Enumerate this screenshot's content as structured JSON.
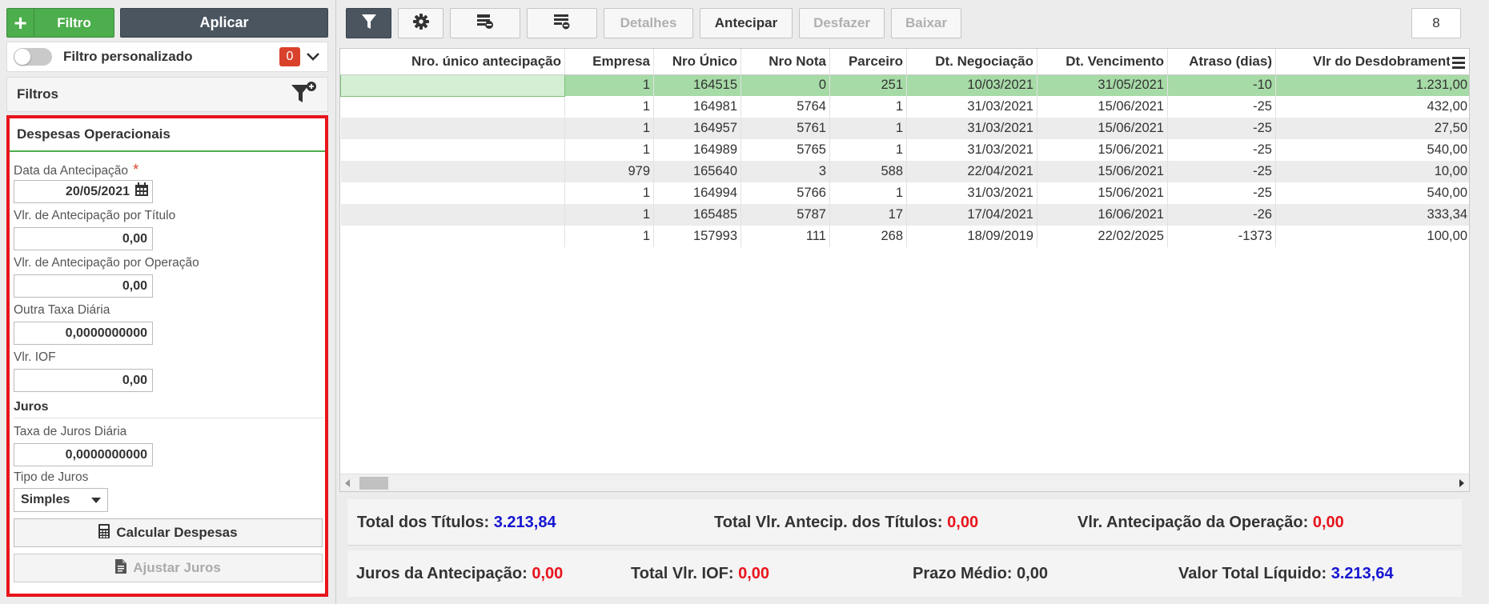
{
  "left": {
    "filtro_button": "Filtro",
    "aplicar_button": "Aplicar",
    "custom_filter": {
      "label": "Filtro personalizado",
      "count": "0"
    },
    "filtros_label": "Filtros",
    "ops": {
      "title": "Despesas Operacionais",
      "data_antecipacao_label": "Data da Antecipação",
      "required_mark": "*",
      "data_antecipacao_value": "20/05/2021",
      "vlr_titulo_label": "Vlr. de Antecipação por Título",
      "vlr_titulo_value": "0,00",
      "vlr_operacao_label": "Vlr. de Antecipação por Operação",
      "vlr_operacao_value": "0,00",
      "outra_taxa_label": "Outra Taxa Diária",
      "outra_taxa_value": "0,0000000000",
      "vlr_iof_label": "Vlr. IOF",
      "vlr_iof_value": "0,00",
      "juros_section": "Juros",
      "taxa_juros_label": "Taxa de Juros Diária",
      "taxa_juros_value": "0,0000000000",
      "tipo_juros_label": "Tipo de Juros",
      "tipo_juros_value": "Simples",
      "calcular_button": "Calcular Despesas",
      "ajustar_button": "Ajustar Juros"
    }
  },
  "toolbar": {
    "detalhes": "Detalhes",
    "antecipar": "Antecipar",
    "desfazer": "Desfazer",
    "baixar": "Baixar",
    "page_count": "8"
  },
  "grid": {
    "columns": [
      "Nro. único antecipação",
      "Empresa",
      "Nro Único",
      "Nro Nota",
      "Parceiro",
      "Dt. Negociação",
      "Dt. Vencimento",
      "Atraso (dias)",
      "Vlr do Desdobramento"
    ],
    "rows": [
      [
        "",
        "1",
        "164515",
        "0",
        "251",
        "10/03/2021",
        "31/05/2021",
        "-10",
        "1.231,00"
      ],
      [
        "",
        "1",
        "164981",
        "5764",
        "1",
        "31/03/2021",
        "15/06/2021",
        "-25",
        "432,00"
      ],
      [
        "",
        "1",
        "164957",
        "5761",
        "1",
        "31/03/2021",
        "15/06/2021",
        "-25",
        "27,50"
      ],
      [
        "",
        "1",
        "164989",
        "5765",
        "1",
        "31/03/2021",
        "15/06/2021",
        "-25",
        "540,00"
      ],
      [
        "",
        "979",
        "165640",
        "3",
        "588",
        "22/04/2021",
        "15/06/2021",
        "-25",
        "10,00"
      ],
      [
        "",
        "1",
        "164994",
        "5766",
        "1",
        "31/03/2021",
        "15/06/2021",
        "-25",
        "540,00"
      ],
      [
        "",
        "1",
        "165485",
        "5787",
        "17",
        "17/04/2021",
        "16/06/2021",
        "-26",
        "333,34"
      ],
      [
        "",
        "1",
        "157993",
        "111",
        "268",
        "18/09/2019",
        "22/02/2025",
        "-1373",
        "100,00"
      ]
    ]
  },
  "totals": {
    "total_titulos_label": "Total dos Títulos:",
    "total_titulos_value": "3.213,84",
    "total_antecip_label": "Total Vlr. Antecip. dos Títulos:",
    "total_antecip_value": "0,00",
    "vlr_antecip_op_label": "Vlr. Antecipação da Operação:",
    "vlr_antecip_op_value": "0,00",
    "juros_antecip_label": "Juros da Antecipação:",
    "juros_antecip_value": "0,00",
    "total_iof_label": "Total Vlr. IOF:",
    "total_iof_value": "0,00",
    "prazo_medio_label": "Prazo Médio:",
    "prazo_medio_value": "0,00",
    "valor_liquido_label": "Valor Total Líquido:",
    "valor_liquido_value": "3.213,64"
  },
  "colors": {
    "green": "#4cae4c",
    "dark": "#4a5560",
    "red": "#e8141c",
    "blue": "#1515d0",
    "selected_row": "#a6daa6"
  }
}
